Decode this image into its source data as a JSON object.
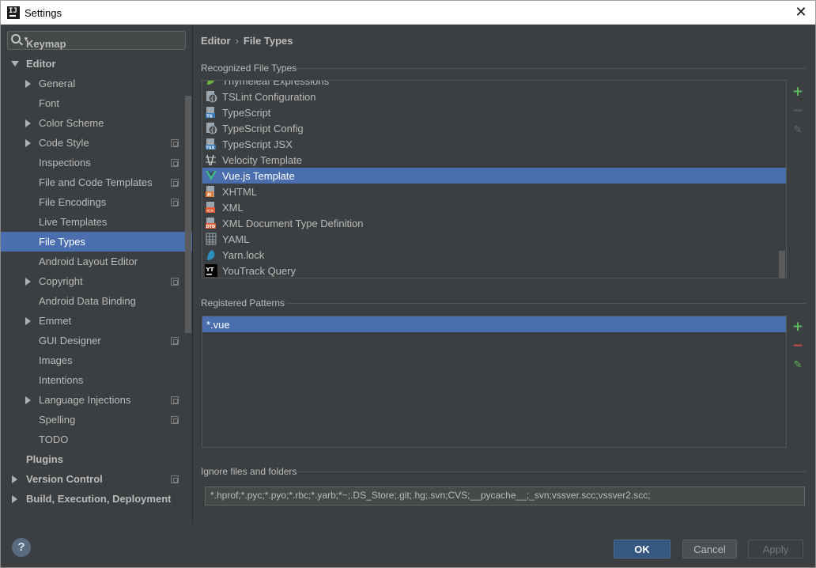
{
  "window": {
    "title": "Settings"
  },
  "search": {
    "placeholder": ""
  },
  "sidebar": {
    "items": [
      {
        "label": "Keymap",
        "level": 0,
        "bold": true,
        "arrow": "none",
        "project": false
      },
      {
        "label": "Editor",
        "level": 0,
        "bold": true,
        "arrow": "down",
        "project": false
      },
      {
        "label": "General",
        "level": 1,
        "arrow": "right",
        "project": false
      },
      {
        "label": "Font",
        "level": 1,
        "arrow": "none",
        "project": false
      },
      {
        "label": "Color Scheme",
        "level": 1,
        "arrow": "right",
        "project": false
      },
      {
        "label": "Code Style",
        "level": 1,
        "arrow": "right",
        "project": true
      },
      {
        "label": "Inspections",
        "level": 1,
        "arrow": "none",
        "project": true
      },
      {
        "label": "File and Code Templates",
        "level": 1,
        "arrow": "none",
        "project": true
      },
      {
        "label": "File Encodings",
        "level": 1,
        "arrow": "none",
        "project": true
      },
      {
        "label": "Live Templates",
        "level": 1,
        "arrow": "none",
        "project": false
      },
      {
        "label": "File Types",
        "level": 1,
        "arrow": "none",
        "project": false,
        "selected": true
      },
      {
        "label": "Android Layout Editor",
        "level": 1,
        "arrow": "none",
        "project": false
      },
      {
        "label": "Copyright",
        "level": 1,
        "arrow": "right",
        "project": true
      },
      {
        "label": "Android Data Binding",
        "level": 1,
        "arrow": "none",
        "project": false
      },
      {
        "label": "Emmet",
        "level": 1,
        "arrow": "right",
        "project": false
      },
      {
        "label": "GUI Designer",
        "level": 1,
        "arrow": "none",
        "project": true
      },
      {
        "label": "Images",
        "level": 1,
        "arrow": "none",
        "project": false
      },
      {
        "label": "Intentions",
        "level": 1,
        "arrow": "none",
        "project": false
      },
      {
        "label": "Language Injections",
        "level": 1,
        "arrow": "right",
        "project": true
      },
      {
        "label": "Spelling",
        "level": 1,
        "arrow": "none",
        "project": true
      },
      {
        "label": "TODO",
        "level": 1,
        "arrow": "none",
        "project": false
      },
      {
        "label": "Plugins",
        "level": 0,
        "bold": true,
        "arrow": "none",
        "project": false
      },
      {
        "label": "Version Control",
        "level": 0,
        "bold": true,
        "arrow": "right",
        "project": true
      },
      {
        "label": "Build, Execution, Deployment",
        "level": 0,
        "bold": true,
        "arrow": "right",
        "project": false
      }
    ]
  },
  "breadcrumb": {
    "parent": "Editor",
    "separator": "›",
    "current": "File Types"
  },
  "recognized": {
    "title": "Recognized File Types",
    "items": [
      {
        "label": "Thymeleaf Expressions",
        "icon": "thymeleaf-icon"
      },
      {
        "label": "TSLint Configuration",
        "icon": "tslint-icon"
      },
      {
        "label": "TypeScript",
        "icon": "typescript-icon"
      },
      {
        "label": "TypeScript Config",
        "icon": "tsconfig-icon"
      },
      {
        "label": "TypeScript JSX",
        "icon": "tsx-icon"
      },
      {
        "label": "Velocity Template",
        "icon": "velocity-icon"
      },
      {
        "label": "Vue.js Template",
        "icon": "vue-icon",
        "selected": true
      },
      {
        "label": "XHTML",
        "icon": "xhtml-icon"
      },
      {
        "label": "XML",
        "icon": "xml-icon"
      },
      {
        "label": "XML Document Type Definition",
        "icon": "dtd-icon"
      },
      {
        "label": "YAML",
        "icon": "yaml-icon"
      },
      {
        "label": "Yarn.lock",
        "icon": "yarn-icon"
      },
      {
        "label": "YouTrack Query",
        "icon": "youtrack-icon"
      }
    ]
  },
  "patterns": {
    "title": "Registered Patterns",
    "items": [
      {
        "label": "*.vue",
        "selected": true
      }
    ]
  },
  "ignore": {
    "title": "Ignore files and folders",
    "value": "*.hprof;*.pyc;*.pyo;*.rbc;*.yarb;*~;.DS_Store;.git;.hg;.svn;CVS;__pycache__;_svn;vssver.scc;vssver2.scc;"
  },
  "buttons": {
    "ok": "OK",
    "cancel": "Cancel",
    "apply": "Apply",
    "help": "?"
  },
  "colors": {
    "accent": "#4b6eaf",
    "background": "#3c3f41",
    "ok_button": "#365880",
    "add": "#5fb85f",
    "remove": "#c74a4a"
  }
}
